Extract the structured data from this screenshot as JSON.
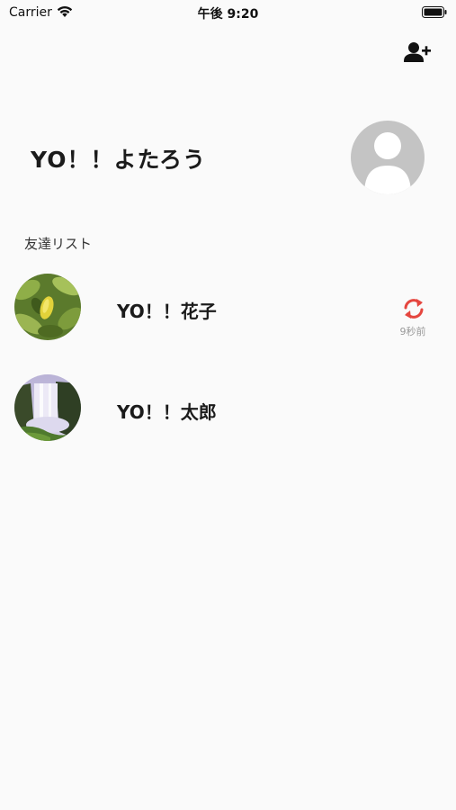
{
  "status_bar": {
    "carrier": "Carrier",
    "time": "午後 9:20"
  },
  "header": {
    "add_friend_icon": "person-add-icon"
  },
  "profile": {
    "name": "YO！！よたろう",
    "avatar_icon": "default-person-avatar"
  },
  "friends_section": {
    "title": "友達リスト",
    "friends": [
      {
        "name": "YO！！花子",
        "status_icon": "sync-icon",
        "status_color": "#e5463f",
        "time_ago": "9秒前"
      },
      {
        "name": "YO！！太郎"
      }
    ]
  },
  "colors": {
    "background": "#fafafa",
    "accent_red": "#e5463f",
    "avatar_gray": "#c4c4c4"
  }
}
